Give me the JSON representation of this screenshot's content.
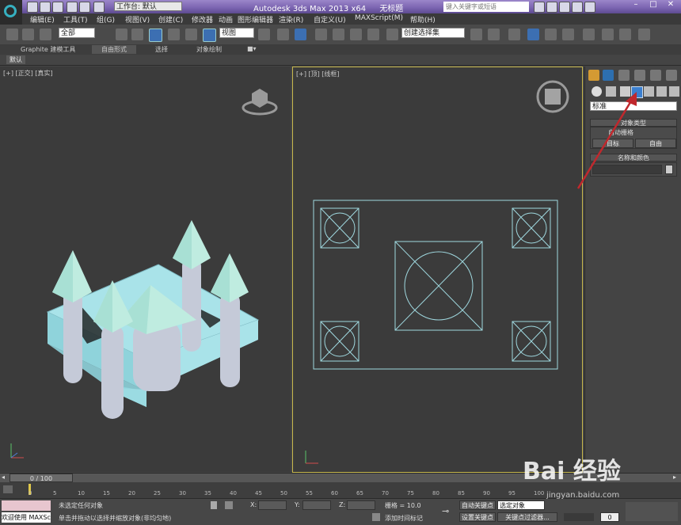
{
  "window": {
    "title": "Autodesk 3ds Max  2013 x64",
    "file_name": "无标题",
    "workspace_label": "工作台: 默认",
    "search_placeholder": "键入关键字或短语"
  },
  "menu": [
    "编辑(E)",
    "工具(T)",
    "组(G)",
    "视图(V)",
    "创建(C)",
    "修改器",
    "动画",
    "图形编辑器",
    "渲染(R)",
    "自定义(U)",
    "MAXScript(M)",
    "帮助(H)"
  ],
  "toolbar": {
    "selection_filter": "全部",
    "ref_coord": "视图",
    "named_selection": "创建选择集"
  },
  "ribbon": {
    "tabs": [
      "Graphite 建模工具",
      "自由形式",
      "选择",
      "对象绘制"
    ],
    "row2_tab": "默认"
  },
  "viewports": {
    "perspective_label": "[+] [正交] [真实]",
    "top_label": "[+] [顶] [线框]"
  },
  "command_panel": {
    "category": "标准",
    "object_type_title": "对象类型",
    "autogrid_label": "自动栅格",
    "buttons": [
      "目标",
      "自由"
    ],
    "name_color_title": "名称和颜色"
  },
  "timeline": {
    "frame_display": "0 / 100",
    "ticks": [
      "0",
      "5",
      "10",
      "15",
      "20",
      "25",
      "30",
      "35",
      "40",
      "45",
      "50",
      "55",
      "60",
      "65",
      "70",
      "75",
      "80",
      "85",
      "90",
      "95",
      "100"
    ]
  },
  "status": {
    "selection": "未选定任何对象",
    "prompt": "单击并拖动以选择并缩放对象(非均匀地)",
    "maxscript": "欢迎使用 MAXSc",
    "x_label": "X:",
    "y_label": "Y:",
    "z_label": "Z:",
    "grid": "栅格 = 10.0",
    "add_time_tag": "添加时间标记",
    "auto_key": "自动关键点",
    "set_key": "设置关键点",
    "selected_dd": "选定对象",
    "key_filters": "关键点过滤器...",
    "frame_field": "0"
  },
  "watermark": {
    "brand": "Bai 经验",
    "url": "jingyan.baidu.com"
  },
  "colors": {
    "viewport_bg": "#3b3b3b",
    "active_viewport_border": "#c8b94e",
    "model_fill": "#a9e3e9",
    "wireframe": "#9fd8df",
    "annotation_arrow": "#c0282d",
    "title_gradient": "#7a63b0"
  }
}
